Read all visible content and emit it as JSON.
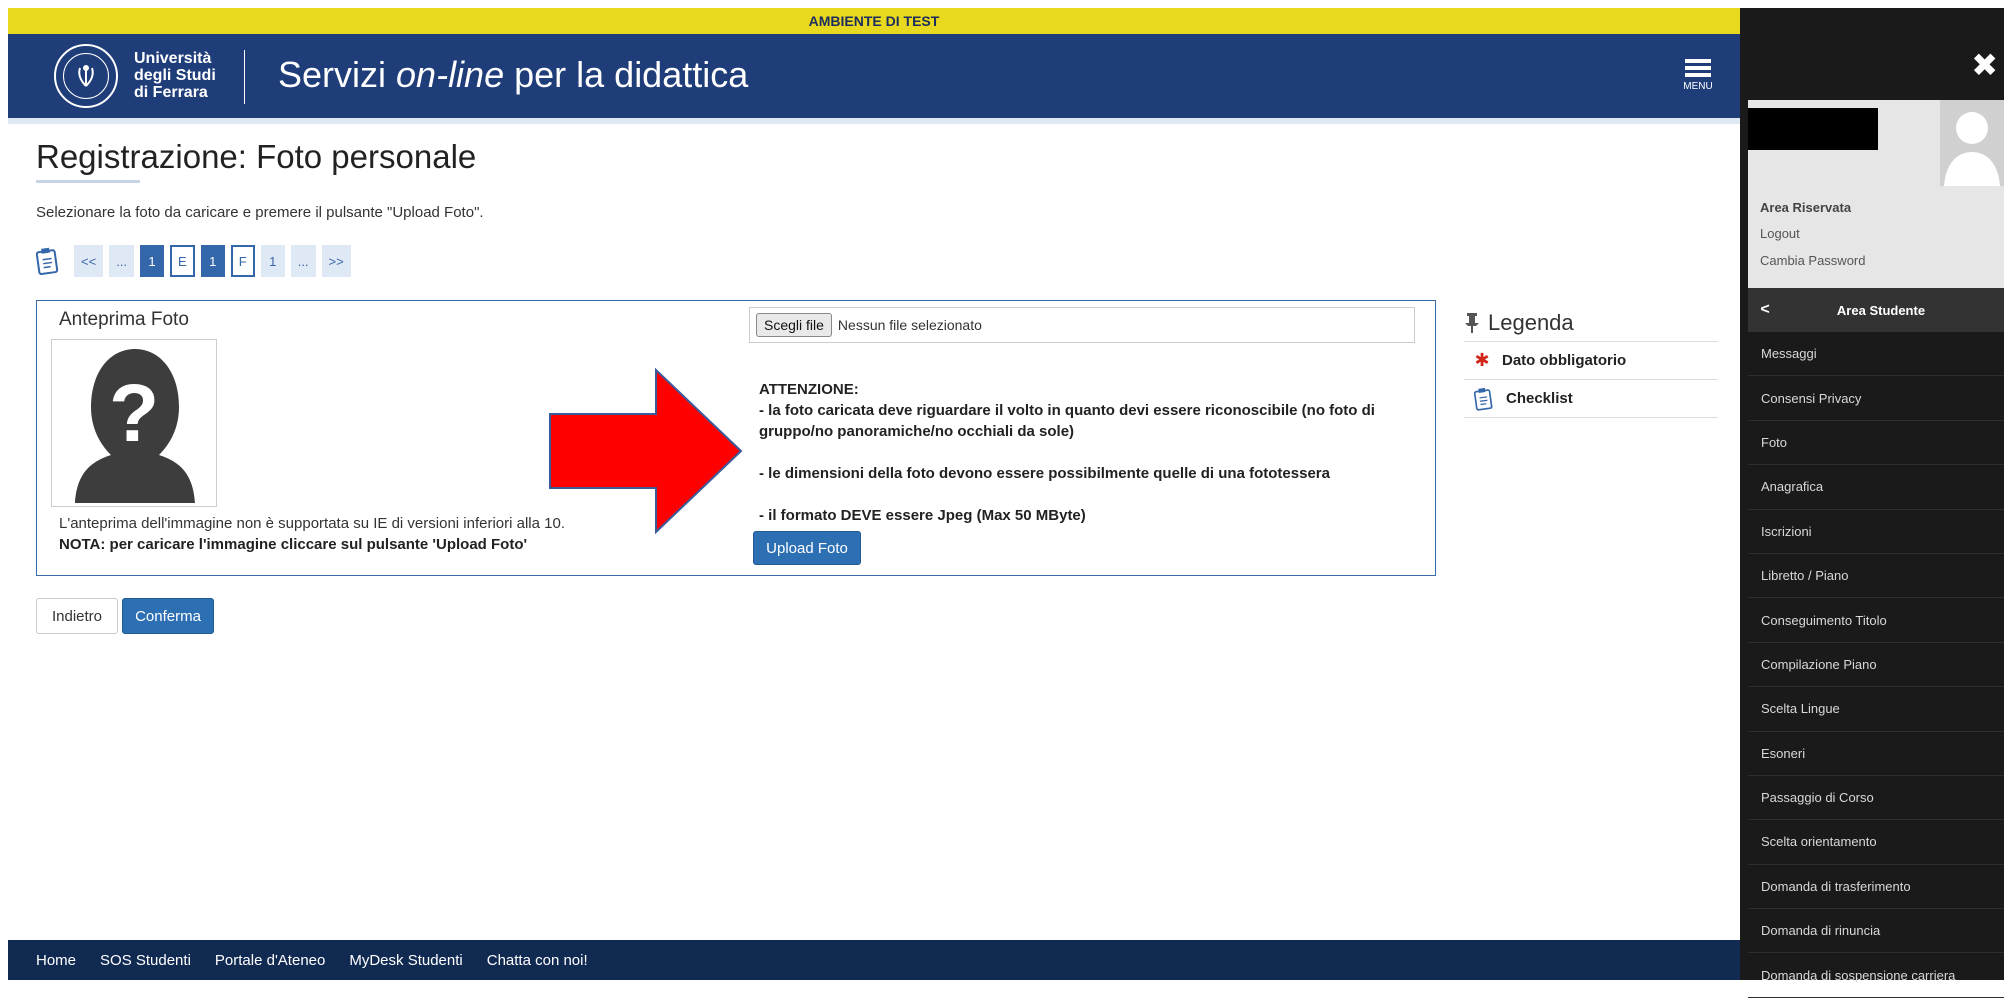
{
  "banner": {
    "text": "AMBIENTE DI TEST"
  },
  "header": {
    "uni_line1": "Università",
    "uni_line2": "degli Studi",
    "uni_line3": "di Ferrara",
    "app_title_pre": "Servizi ",
    "app_title_em": "on-line",
    "app_title_post": " per la didattica",
    "menu_label": "MENU"
  },
  "main": {
    "title": "Registrazione: Foto personale",
    "instructions": "Selezionare la foto da caricare e premere il pulsante \"Upload Foto\".",
    "pager": [
      "<<",
      "...",
      "1",
      "E",
      "1",
      "F",
      "1",
      "...",
      ">>"
    ]
  },
  "photo": {
    "preview_title": "Anteprima Foto",
    "note_ie": "L'anteprima dell'immagine non è supportata su IE di versioni inferiori alla 10.",
    "note_upload": "NOTA: per caricare l'immagine cliccare sul pulsante 'Upload Foto'",
    "file_button": "Scegli file",
    "file_status": "Nessun file selezionato",
    "warning": {
      "head": "ATTENZIONE:",
      "line1": "- la foto caricata deve riguardare il volto in quanto devi essere riconoscibile (no foto di gruppo/no panoramiche/no occhiali da sole)",
      "line2": "- le dimensioni della foto devono essere possibilmente quelle di una fototessera",
      "line3": "- il formato DEVE essere Jpeg (Max 50 MByte)"
    },
    "upload_button": "Upload Foto"
  },
  "legend": {
    "title": "Legenda",
    "items": [
      {
        "label": "Dato obbligatorio"
      },
      {
        "label": "Checklist"
      }
    ]
  },
  "actions": {
    "back": "Indietro",
    "confirm": "Conferma"
  },
  "footer": {
    "links": [
      "Home",
      "SOS Studenti",
      "Portale d'Ateneo",
      "MyDesk Studenti",
      "Chatta con noi!"
    ]
  },
  "side_menu": {
    "area_riservata": "Area Riservata",
    "logout": "Logout",
    "change_password": "Cambia Password",
    "section_title": "Area Studente",
    "items": [
      "Messaggi",
      "Consensi Privacy",
      "Foto",
      "Anagrafica",
      "Iscrizioni",
      "Libretto / Piano",
      "Conseguimento Titolo",
      "Compilazione Piano",
      "Scelta Lingue",
      "Esoneri",
      "Passaggio di Corso",
      "Scelta orientamento",
      "Domanda di trasferimento",
      "Domanda di rinuncia",
      "Domanda di sospensione carriera"
    ]
  },
  "colors": {
    "header_blue": "#1f3d79",
    "banner_yellow": "#e8d81e",
    "primary_button": "#2d6fb3",
    "footer_navy": "#112a52",
    "side_menu_bg": "#1a1a1a",
    "arrow_red": "#ff0000"
  }
}
